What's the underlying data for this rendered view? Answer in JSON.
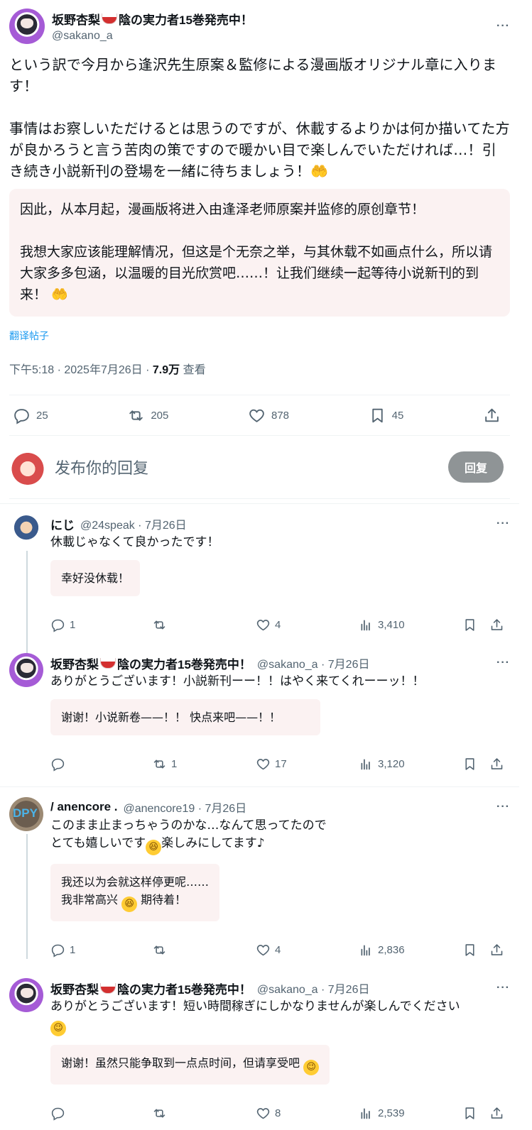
{
  "main_post": {
    "author_name": "坂野杏梨",
    "author_suffix": "陰の実力者15巻発売中！",
    "author_handle": "@sakano_a",
    "more_label": "···",
    "text": "という訳で今月から逢沢先生原案＆監修による漫画版オリジナル章に入ります！\n\n事情はお察しいただけるとは思うのですが、休載するよりかは何か描いてた方が良かろうと言う苦肉の策ですので暖かい目で楽しんでいただければ…！引き続き小説新刊の登場を一緒に待ちましょう！🤲",
    "translation": "因此，从本月起，漫画版将进入由逢泽老师原案并监修的原创章节！\n\n我想大家应该能理解情况，但这是个无奈之举，与其休载不如画点什么，所以请大家多多包涵，以温暖的目光欣赏吧……！让我们继续一起等待小说新刊的到来！ 🤲",
    "translate_link": "翻译帖子",
    "time": "下午5:18 · 2025年7月26日 · ",
    "views_count": "7.9万",
    "views_label": " 查看",
    "stats": {
      "replies": "25",
      "reposts": "205",
      "likes": "878",
      "bookmarks": "45"
    }
  },
  "reply_box": {
    "placeholder": "发布你的回复",
    "button_label": "回复"
  },
  "replies": [
    {
      "name": "にじ",
      "handle_date": "@24speak · 7月26日",
      "text": "休載じゃなくて良かったです！",
      "translation": "幸好没休载！",
      "replies": "1",
      "reposts": "",
      "likes": "4",
      "views": "3,410"
    },
    {
      "name": "坂野杏梨",
      "suffix": "陰の実力者15巻発売中！",
      "handle_date": "@sakano_a · 7月26日",
      "text": "ありがとうございます！小説新刊ーー！！はやく来てくれーーッ！！",
      "translation": "谢谢！小说新卷——！！ 快点来吧——！！",
      "replies": "",
      "reposts": "1",
      "likes": "17",
      "views": "3,120"
    },
    {
      "name": "/ anencore .",
      "handle_date": "@anencore19 · 7月26日",
      "text_line1": "このまま止まっちゃうのかな…なんて思ってたので",
      "text_line2a": "とても嬉しいです",
      "text_line2b": "楽しみにしてます♪",
      "translation_line1": "我还以为会就这样停更呢……",
      "translation_line2a": "我非常高兴 ",
      "translation_line2b": " 期待着！",
      "replies": "1",
      "reposts": "",
      "likes": "4",
      "views": "2,836"
    },
    {
      "name": "坂野杏梨",
      "suffix": "陰の実力者15巻発売中！",
      "handle_date": "@sakano_a · 7月26日",
      "text": "ありがとうございます！短い時間稼ぎにしかなりませんが楽しんでください",
      "translation": "谢谢！虽然只能争取到一点点时间，但请享受吧 ",
      "replies": "",
      "reposts": "",
      "likes": "8",
      "views": "2,539"
    }
  ],
  "emoji": {
    "grin": "😆",
    "wink": "😉"
  },
  "colors": {
    "accent": "#1d9bf0",
    "muted": "#536471",
    "translation_bg": "#fbf2f2",
    "reply_button": "#8f9496"
  }
}
